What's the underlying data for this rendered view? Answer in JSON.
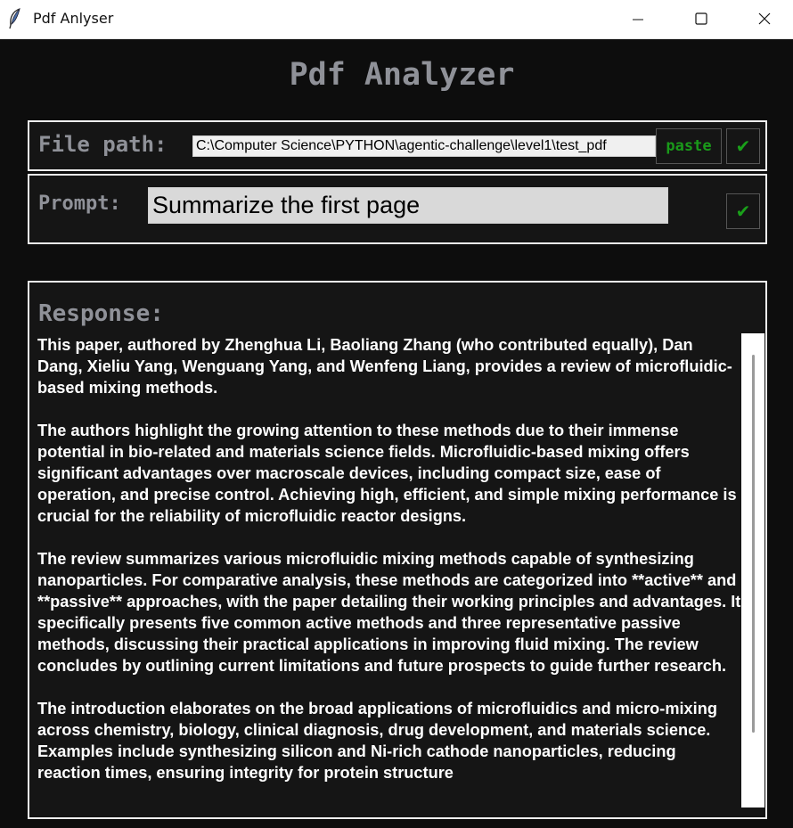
{
  "window": {
    "title": "Pdf Anlyser",
    "icon": "feather-icon",
    "controls": [
      "minimize-icon",
      "maximize-icon",
      "close-icon"
    ]
  },
  "app": {
    "heading": "Pdf Analyzer"
  },
  "file_path": {
    "label": "File path:",
    "value": "C:\\Computer Science\\PYTHON\\agentic-challenge\\level1\\test_pdf",
    "paste_label": "paste",
    "confirm_label": "✔"
  },
  "prompt": {
    "label": "Prompt:",
    "value": "Summarize the first page",
    "confirm_label": "✔"
  },
  "response": {
    "label": "Response:",
    "paragraphs": [
      "This paper, authored by Zhenghua Li, Baoliang Zhang (who contributed equally), Dan Dang, Xieliu Yang, Wenguang Yang, and Wenfeng Liang, provides a review of microfluidic-based mixing methods.",
      "The authors highlight the growing attention to these methods due to their immense potential in bio-related and materials science fields. Microfluidic-based mixing offers significant advantages over macroscale devices, including compact size, ease of operation, and precise control. Achieving high, efficient, and simple mixing performance is crucial for the reliability of microfluidic reactor designs.",
      "The review summarizes various microfluidic mixing methods capable of synthesizing nanoparticles. For comparative analysis, these methods are categorized into **active** and **passive** approaches, with the paper detailing their working principles and advantages. It specifically presents five common active methods and three representative passive methods, discussing their practical applications in improving fluid mixing. The review concludes by outlining current limitations and future prospects to guide further research.",
      "The introduction elaborates on the broad applications of microfluidics and micro-mixing across chemistry, biology, clinical diagnosis, drug development, and materials science. Examples include synthesizing silicon and Ni-rich cathode nanoparticles, reducing reaction times, ensuring integrity for protein structure"
    ]
  },
  "colors": {
    "background": "#0d0d0d",
    "label": "#8f9198",
    "accent_green": "#1a9a1a",
    "panel_border": "#eeeeee"
  }
}
